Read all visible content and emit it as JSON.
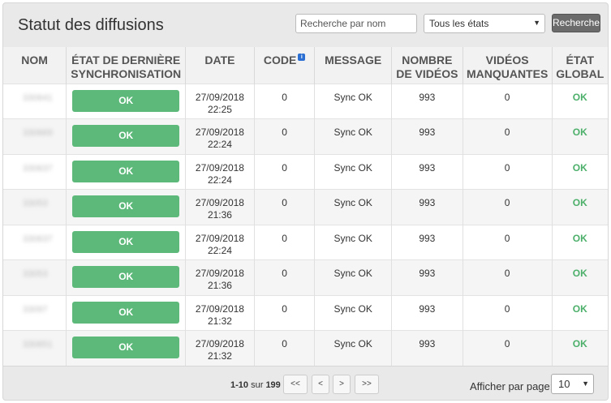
{
  "header": {
    "title": "Statut des diffusions",
    "search_placeholder": "Recherche par nom",
    "state_filter": "Tous les états",
    "search_button": "Recherche"
  },
  "columns": {
    "name": "NOM",
    "sync_state_1": "ÉTAT DE DERNIÈRE",
    "sync_state_2": "SYNCHRONISATION",
    "date": "DATE",
    "code": "CODE",
    "message": "MESSAGE",
    "videos_1": "NOMBRE",
    "videos_2": "DE VIDÉOS",
    "missing_1": "VIDÉOS",
    "missing_2": "MANQUANTES",
    "global_1": "ÉTAT",
    "global_2": "GLOBAL"
  },
  "rows": [
    {
      "name": "330641",
      "sync": "OK",
      "date": "27/09/2018",
      "time": "22:25",
      "code": "0",
      "message": "Sync OK",
      "videos": "993",
      "missing": "0",
      "global": "OK"
    },
    {
      "name": "330669",
      "sync": "OK",
      "date": "27/09/2018",
      "time": "22:24",
      "code": "0",
      "message": "Sync OK",
      "videos": "993",
      "missing": "0",
      "global": "OK"
    },
    {
      "name": "330637",
      "sync": "OK",
      "date": "27/09/2018",
      "time": "22:24",
      "code": "0",
      "message": "Sync OK",
      "videos": "993",
      "missing": "0",
      "global": "OK"
    },
    {
      "name": "33053",
      "sync": "OK",
      "date": "27/09/2018",
      "time": "21:36",
      "code": "0",
      "message": "Sync OK",
      "videos": "993",
      "missing": "0",
      "global": "OK"
    },
    {
      "name": "330637",
      "sync": "OK",
      "date": "27/09/2018",
      "time": "22:24",
      "code": "0",
      "message": "Sync OK",
      "videos": "993",
      "missing": "0",
      "global": "OK"
    },
    {
      "name": "33053",
      "sync": "OK",
      "date": "27/09/2018",
      "time": "21:36",
      "code": "0",
      "message": "Sync OK",
      "videos": "993",
      "missing": "0",
      "global": "OK"
    },
    {
      "name": "33097",
      "sync": "OK",
      "date": "27/09/2018",
      "time": "21:32",
      "code": "0",
      "message": "Sync OK",
      "videos": "993",
      "missing": "0",
      "global": "OK"
    },
    {
      "name": "330651",
      "sync": "OK",
      "date": "27/09/2018",
      "time": "21:32",
      "code": "0",
      "message": "Sync OK",
      "videos": "993",
      "missing": "0",
      "global": "OK"
    }
  ],
  "footer": {
    "range": "1-10",
    "of": "sur",
    "total": "199",
    "first": "<<",
    "prev": "<",
    "next": ">",
    "last": ">>",
    "per_page_label": "Afficher par page:",
    "per_page_value": "10"
  },
  "icons": {
    "info": "info-icon",
    "dropdown": "chevron-down-icon"
  },
  "colors": {
    "ok_button": "#5cb97a",
    "ok_text": "#4caf6a",
    "search_button": "#6b6b6b"
  }
}
